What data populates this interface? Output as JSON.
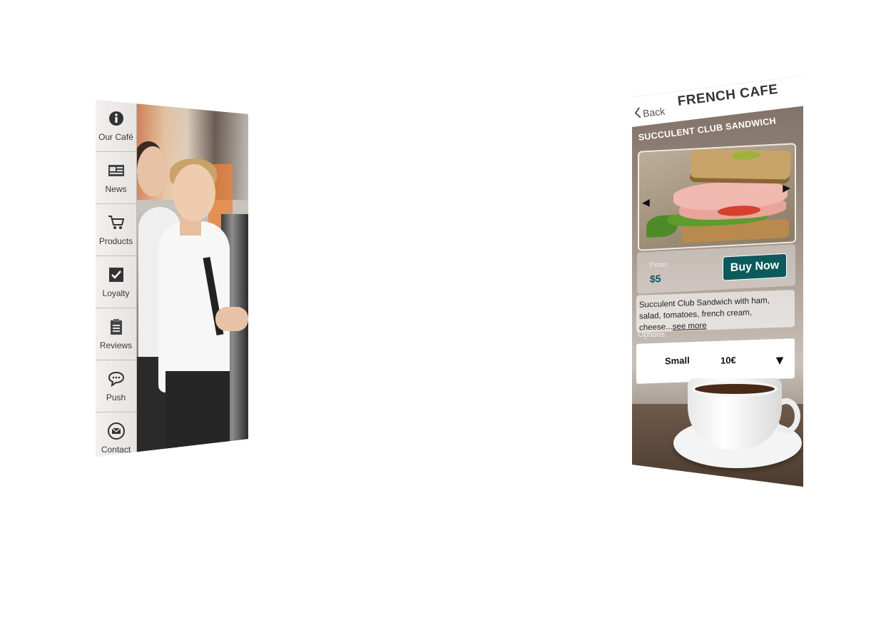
{
  "left_screen": {
    "sidebar": {
      "items": [
        {
          "label": "Our Café",
          "icon": "info-icon"
        },
        {
          "label": "News",
          "icon": "newspaper-icon"
        },
        {
          "label": "Products",
          "icon": "cart-icon"
        },
        {
          "label": "Loyalty",
          "icon": "checkbox-icon"
        },
        {
          "label": "Reviews",
          "icon": "clipboard-icon"
        },
        {
          "label": "Push",
          "icon": "chat-bubble-icon"
        },
        {
          "label": "Contact",
          "icon": "envelope-icon"
        }
      ]
    }
  },
  "right_screen": {
    "header": {
      "back_label": "Back",
      "title": "FRENCH CAFE"
    },
    "product": {
      "title": "SUCCULENT CLUB SANDWICH",
      "from_label": "From:",
      "price": "$5",
      "buy_label": "Buy Now",
      "description": "Succulent Club Sandwich with ham, salad, tomatoes, french cream, cheese...",
      "see_more": "see more",
      "options_label": "Options:",
      "selected_option": {
        "size": "Small",
        "price": "10€"
      }
    },
    "colors": {
      "accent": "#0d5a5c"
    }
  }
}
